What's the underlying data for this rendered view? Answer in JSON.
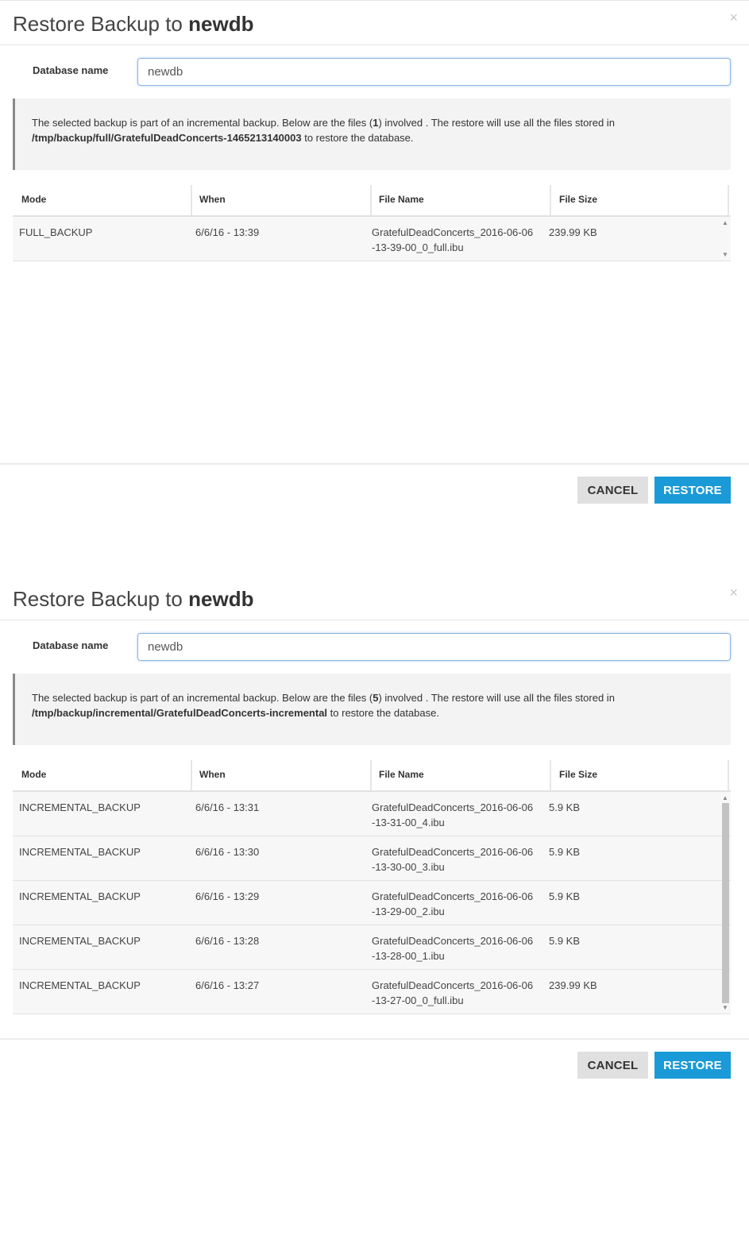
{
  "dialogs": [
    {
      "title_prefix": "Restore Backup to ",
      "title_db": "newdb",
      "close_glyph": "×",
      "db_label": "Database name",
      "db_value": "newdb",
      "info_text_1": "The selected backup is part of an incremental backup. Below are the files (",
      "info_count": "1",
      "info_text_2": ") involved . The restore will use all the files stored in ",
      "info_path": "/tmp/backup/full/GratefulDeadConcerts-1465213140003",
      "info_text_3": " to restore the database.",
      "columns": [
        "Mode",
        "When",
        "File Name",
        "File Size"
      ],
      "rows": [
        {
          "mode": "FULL_BACKUP",
          "when": "6/6/16 - 13:39",
          "file_name": "GratefulDeadConcerts_2016-06-06-13-39-00_0_full.ibu",
          "file_size": "239.99 KB"
        }
      ],
      "cancel_label": "CANCEL",
      "restore_label": "RESTORE"
    },
    {
      "title_prefix": "Restore Backup to ",
      "title_db": "newdb",
      "close_glyph": "×",
      "db_label": "Database name",
      "db_value": "newdb",
      "info_text_1": "The selected backup is part of an incremental backup. Below are the files (",
      "info_count": "5",
      "info_text_2": ") involved . The restore will use all the files stored in ",
      "info_path": "/tmp/backup/incremental/GratefulDeadConcerts-incremental",
      "info_text_3": " to restore the database.",
      "columns": [
        "Mode",
        "When",
        "File Name",
        "File Size"
      ],
      "rows": [
        {
          "mode": "INCREMENTAL_BACKUP",
          "when": "6/6/16 - 13:31",
          "file_name": "GratefulDeadConcerts_2016-06-06-13-31-00_4.ibu",
          "file_size": "5.9 KB"
        },
        {
          "mode": "INCREMENTAL_BACKUP",
          "when": "6/6/16 - 13:30",
          "file_name": "GratefulDeadConcerts_2016-06-06-13-30-00_3.ibu",
          "file_size": "5.9 KB"
        },
        {
          "mode": "INCREMENTAL_BACKUP",
          "when": "6/6/16 - 13:29",
          "file_name": "GratefulDeadConcerts_2016-06-06-13-29-00_2.ibu",
          "file_size": "5.9 KB"
        },
        {
          "mode": "INCREMENTAL_BACKUP",
          "when": "6/6/16 - 13:28",
          "file_name": "GratefulDeadConcerts_2016-06-06-13-28-00_1.ibu",
          "file_size": "5.9 KB"
        },
        {
          "mode": "INCREMENTAL_BACKUP",
          "when": "6/6/16 - 13:27",
          "file_name": "GratefulDeadConcerts_2016-06-06-13-27-00_0_full.ibu",
          "file_size": "239.99 KB"
        }
      ],
      "cancel_label": "CANCEL",
      "restore_label": "RESTORE"
    }
  ],
  "colors": {
    "accent": "#1a9ad6",
    "cancel_bg": "#e0e0e0",
    "info_bg": "#f3f3f3"
  }
}
